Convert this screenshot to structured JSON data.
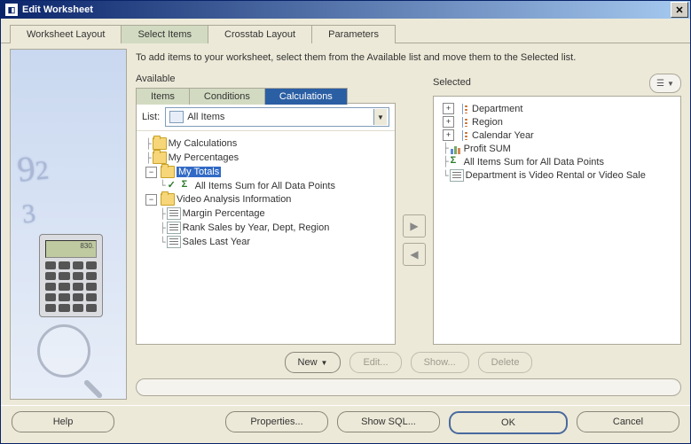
{
  "window": {
    "title": "Edit Worksheet"
  },
  "tabs": {
    "worksheet_layout": "Worksheet Layout",
    "select_items": "Select Items",
    "crosstab_layout": "Crosstab Layout",
    "parameters": "Parameters"
  },
  "instruction": "To add items to your worksheet, select them from the Available list and move them to the Selected list.",
  "available": {
    "label": "Available",
    "subtabs": {
      "items": "Items",
      "conditions": "Conditions",
      "calculations": "Calculations"
    },
    "list_label": "List:",
    "list_value": "All Items",
    "tree": {
      "my_calc": "My Calculations",
      "my_perc": "My Percentages",
      "my_totals": "My Totals",
      "all_items_sum": "All Items Sum for All Data Points",
      "video_folder": "Video Analysis Information",
      "margin_pct": "Margin Percentage",
      "rank_sales": "Rank Sales by Year, Dept, Region",
      "sales_last_year": "Sales Last Year"
    }
  },
  "selected": {
    "label": "Selected",
    "tree": {
      "department": "Department",
      "region": "Region",
      "calendar_year": "Calendar Year",
      "profit_sum": "Profit SUM",
      "all_items_sum": "All Items Sum for All Data Points",
      "dept_video": "Department is Video Rental or Video Sale"
    }
  },
  "buttons": {
    "new": "New",
    "edit": "Edit...",
    "show": "Show...",
    "delete": "Delete",
    "help": "Help",
    "properties": "Properties...",
    "show_sql": "Show SQL...",
    "ok": "OK",
    "cancel": "Cancel"
  },
  "calc_display": "830."
}
